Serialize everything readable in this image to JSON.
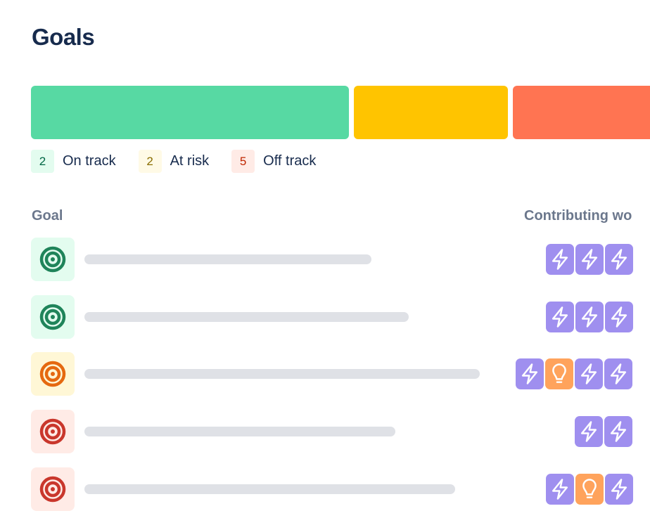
{
  "page": {
    "title": "Goals"
  },
  "colors": {
    "on_track": "#57d9a3",
    "at_risk": "#ffc400",
    "off_track": "#ff7452",
    "bolt_chip": "#9f8fef",
    "idea_chip": "#ffa35c",
    "placeholder_bar": "#dfe1e6"
  },
  "summary": {
    "on_track": 2,
    "at_risk": 2,
    "off_track": 5
  },
  "legend": [
    {
      "count": "2",
      "label": "On track",
      "bg": "#e3fcef",
      "fg": "#006644"
    },
    {
      "count": "2",
      "label": "At risk",
      "bg": "#fffae6",
      "fg": "#8a6d00"
    },
    {
      "count": "5",
      "label": "Off track",
      "bg": "#ffebe6",
      "fg": "#bf2600"
    }
  ],
  "table": {
    "columns": {
      "goal": "Goal",
      "work": "Contributing wo"
    },
    "rows": [
      {
        "status": "on-track",
        "icon": "target-icon",
        "icon_bg": "#e3fcef",
        "icon_color": "#1f845a",
        "work": [
          "bolt-icon",
          "bolt-icon",
          "bolt-icon"
        ]
      },
      {
        "status": "on-track",
        "icon": "target-icon",
        "icon_bg": "#e3fcef",
        "icon_color": "#1f845a",
        "work": [
          "bolt-icon",
          "bolt-icon",
          "bolt-icon"
        ]
      },
      {
        "status": "at-risk",
        "icon": "target-icon",
        "icon_bg": "#fff7d6",
        "icon_color": "#e56910",
        "work": [
          "bolt-icon",
          "lightbulb-icon",
          "bolt-icon",
          "bolt-icon"
        ]
      },
      {
        "status": "off-track",
        "icon": "target-icon",
        "icon_bg": "#ffebe6",
        "icon_color": "#c9372c",
        "work": [
          "bolt-icon",
          "bolt-icon"
        ]
      },
      {
        "status": "off-track",
        "icon": "target-icon",
        "icon_bg": "#ffebe6",
        "icon_color": "#c9372c",
        "work": [
          "bolt-icon",
          "lightbulb-icon",
          "bolt-icon"
        ]
      }
    ]
  }
}
